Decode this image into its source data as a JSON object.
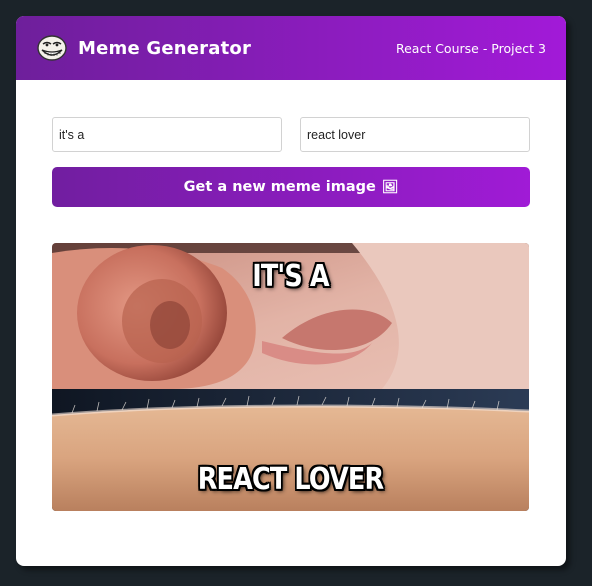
{
  "header": {
    "title": "Meme Generator",
    "subtitle": "React Course - Project 3",
    "logo_icon": "troll-face-icon"
  },
  "form": {
    "top_text_value": "it's a",
    "bottom_text_value": "react lover",
    "button_label": "Get a new meme image",
    "button_emoji": "🖼"
  },
  "meme": {
    "top_text": "IT'S A",
    "bottom_text": "REACT LOVER",
    "image_description": "whisper-goosebumps meme"
  },
  "colors": {
    "background": "#1b2329",
    "gradient_start": "#6e1f9b",
    "gradient_end": "#a21ad8",
    "card": "#ffffff"
  }
}
